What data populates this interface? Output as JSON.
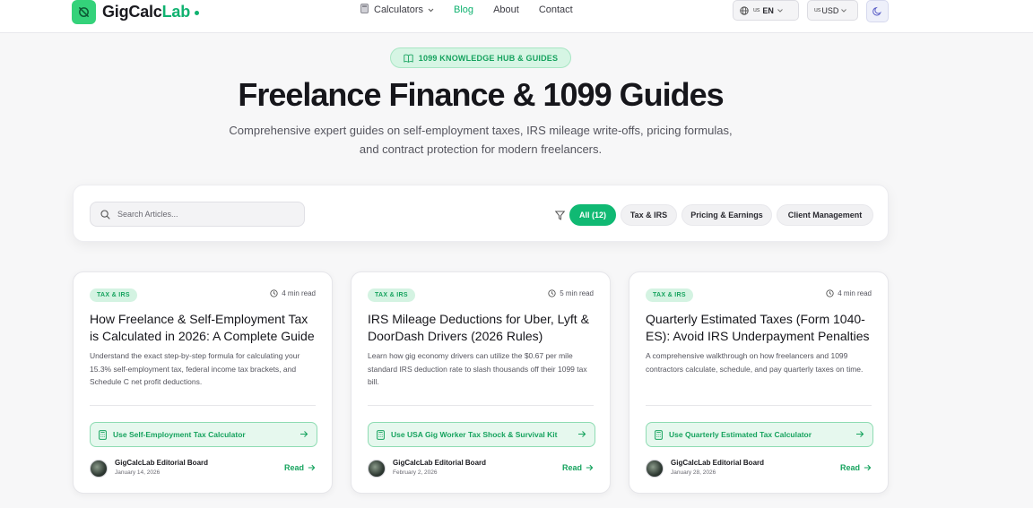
{
  "header": {
    "brand_a": "GigCalc",
    "brand_b": "Lab",
    "nav": {
      "calculators": "Calculators",
      "blog": "Blog",
      "about": "About",
      "contact": "Contact"
    },
    "language": {
      "flag": "us",
      "code": "EN"
    },
    "currency": {
      "flag": "us",
      "code": "USD"
    }
  },
  "hero": {
    "badge": "1099 KNOWLEDGE HUB & GUIDES",
    "title": "Freelance Finance & 1099 Guides",
    "subtitle": "Comprehensive expert guides on self-employment taxes, IRS mileage write-offs, pricing formulas, and contract protection for modern freelancers."
  },
  "search": {
    "placeholder": "Search Articles..."
  },
  "filters": [
    {
      "label": "All (12)",
      "active": true
    },
    {
      "label": "Tax & IRS",
      "active": false
    },
    {
      "label": "Pricing & Earnings",
      "active": false
    },
    {
      "label": "Client Management",
      "active": false
    }
  ],
  "articles": [
    {
      "tag": "TAX & IRS",
      "read_time": "4 min read",
      "title": "How Freelance & Self-Employment Tax is Calculated in 2026: A Complete Guide",
      "description": "Understand the exact step-by-step formula for calculating your 15.3% self-employment tax, federal income tax brackets, and Schedule C net profit deductions.",
      "cta": "Use Self-Employment Tax Calculator",
      "author": "GigCalcLab Editorial Board",
      "date": "January 14, 2026",
      "read": "Read"
    },
    {
      "tag": "TAX & IRS",
      "read_time": "5 min read",
      "title": "IRS Mileage Deductions for Uber, Lyft & DoorDash Drivers (2026 Rules)",
      "description": "Learn how gig economy drivers can utilize the $0.67 per mile standard IRS deduction rate to slash thousands off their 1099 tax bill.",
      "cta": "Use USA Gig Worker Tax Shock & Survival Kit",
      "author": "GigCalcLab Editorial Board",
      "date": "February 2, 2026",
      "read": "Read"
    },
    {
      "tag": "TAX & IRS",
      "read_time": "4 min read",
      "title": "Quarterly Estimated Taxes (Form 1040-ES): Avoid IRS Underpayment Penalties",
      "description": "A comprehensive walkthrough on how freelancers and 1099 contractors calculate, schedule, and pay quarterly taxes on time.",
      "cta": "Use Quarterly Estimated Tax Calculator",
      "author": "GigCalcLab Editorial Board",
      "date": "January 28, 2026",
      "read": "Read"
    }
  ]
}
